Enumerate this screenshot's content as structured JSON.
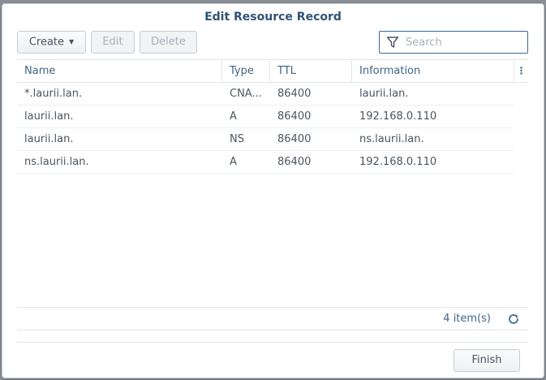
{
  "dialog": {
    "title": "Edit Resource Record"
  },
  "toolbar": {
    "create_label": "Create",
    "edit_label": "Edit",
    "delete_label": "Delete",
    "search_placeholder": "Search"
  },
  "grid": {
    "columns": [
      "Name",
      "Type",
      "TTL",
      "Information"
    ],
    "rows": [
      {
        "name": "*.laurii.lan.",
        "type": "CNA...",
        "ttl": "86400",
        "info": "laurii.lan."
      },
      {
        "name": "laurii.lan.",
        "type": "A",
        "ttl": "86400",
        "info": "192.168.0.110"
      },
      {
        "name": "laurii.lan.",
        "type": "NS",
        "ttl": "86400",
        "info": "ns.laurii.lan."
      },
      {
        "name": "ns.laurii.lan.",
        "type": "A",
        "ttl": "86400",
        "info": "192.168.0.110"
      }
    ]
  },
  "footer": {
    "count_label": "4 item(s)"
  },
  "actions": {
    "finish_label": "Finish"
  },
  "colors": {
    "title": "#2f5377",
    "accent": "#3c6a95",
    "text": "#4a5560"
  },
  "icons": {
    "filter": "filter-icon",
    "refresh": "refresh-icon",
    "column_menu": "column-menu-icon"
  }
}
